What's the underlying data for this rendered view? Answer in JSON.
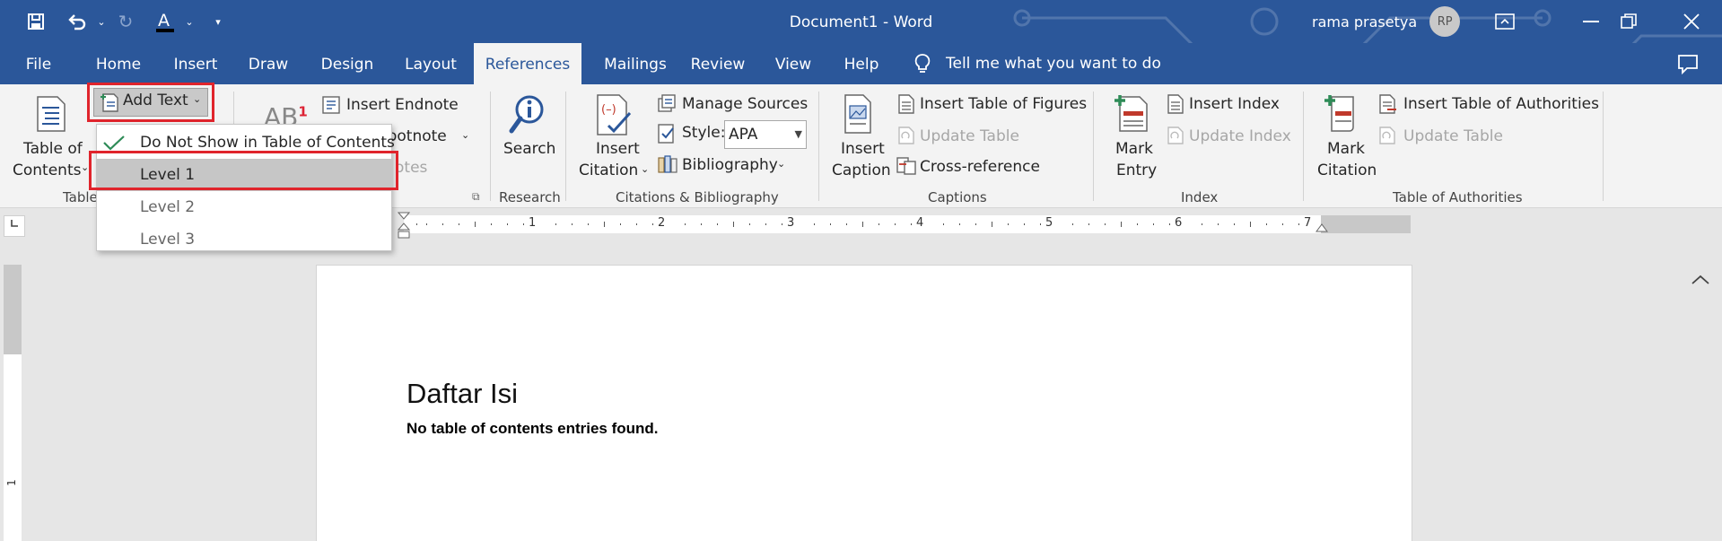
{
  "window": {
    "title": "Document1  -  Word",
    "user_name": "rama prasetya",
    "user_initials": "RP"
  },
  "tabs": [
    "File",
    "Home",
    "Insert",
    "Draw",
    "Design",
    "Layout",
    "References",
    "Mailings",
    "Review",
    "View",
    "Help"
  ],
  "active_tab": "References",
  "tell_me": "Tell me what you want to do",
  "ribbon": {
    "toc": {
      "add_text": "Add Text",
      "table_of_line1": "Table of",
      "table_of_line2": "Contents",
      "group_label": "Table"
    },
    "footnotes": {
      "insert_endnote": "Insert Endnote",
      "next_footnote": "ootnote",
      "show_notes": "otes",
      "ab_label": "AB",
      "ab_sup": "1"
    },
    "research": {
      "search": "Search",
      "group_label": "Research"
    },
    "citations": {
      "insert_citation_line1": "Insert",
      "insert_citation_line2": "Citation",
      "manage_sources": "Manage Sources",
      "style_label": "Style:",
      "style_value": "APA",
      "bibliography": "Bibliography",
      "group_label": "Citations & Bibliography"
    },
    "captions": {
      "insert_caption_line1": "Insert",
      "insert_caption_line2": "Caption",
      "insert_table_of_figures": "Insert Table of Figures",
      "update_table": "Update Table",
      "cross_reference": "Cross-reference",
      "group_label": "Captions"
    },
    "index": {
      "mark_entry_line1": "Mark",
      "mark_entry_line2": "Entry",
      "insert_index": "Insert Index",
      "update_index": "Update Index",
      "group_label": "Index"
    },
    "authorities": {
      "mark_citation_line1": "Mark",
      "mark_citation_line2": "Citation",
      "insert_table_of_authorities": "Insert Table of Authorities",
      "update_table": "Update Table",
      "group_label": "Table of Authorities"
    }
  },
  "add_text_menu": {
    "items": [
      "Do Not Show in Table of Contents",
      "Level 1",
      "Level 2",
      "Level 3"
    ]
  },
  "ruler": {
    "h_numbers": [
      "1",
      "2",
      "3",
      "4",
      "5",
      "6",
      "7"
    ],
    "v_number": "1"
  },
  "document": {
    "heading": "Daftar Isi",
    "note": "No table of contents entries found."
  },
  "colors": {
    "title_bar": "#2b579a",
    "ribbon_bg": "#f3f3f3",
    "highlight_box": "#e0242c",
    "menu_highlight": "#c6c6c6"
  }
}
